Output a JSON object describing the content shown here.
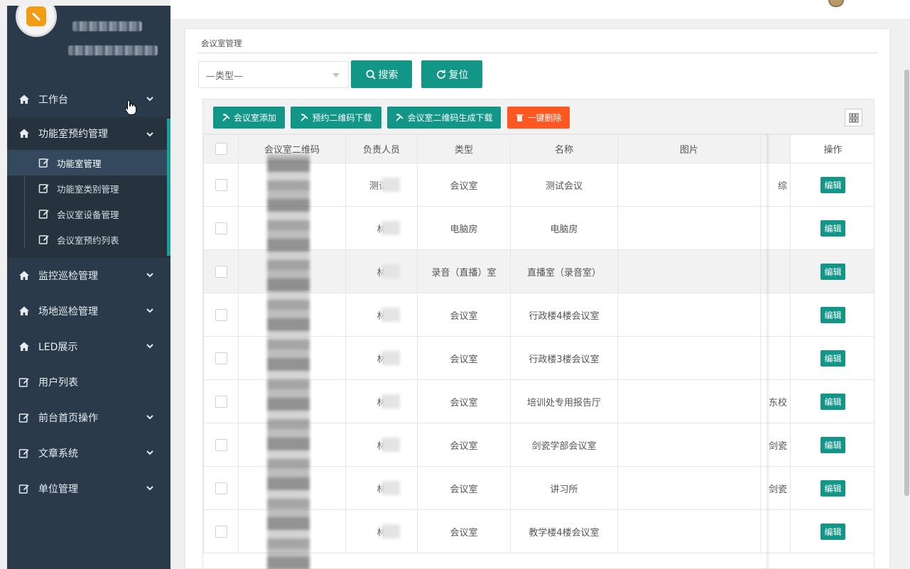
{
  "sidebar": {
    "menu": [
      {
        "label": "工作台",
        "icon": "home-icon",
        "has_chevron": true
      },
      {
        "label": "功能室预约管理",
        "icon": "home-icon",
        "has_chevron": true,
        "open": true,
        "children": [
          {
            "label": "功能室管理",
            "active": true
          },
          {
            "label": "功能室类别管理"
          },
          {
            "label": "会议室设备管理"
          },
          {
            "label": "会议室预约列表"
          }
        ]
      },
      {
        "label": "监控巡检管理",
        "icon": "home-icon",
        "has_chevron": true
      },
      {
        "label": "场地巡检管理",
        "icon": "home-icon",
        "has_chevron": true
      },
      {
        "label": "LED展示",
        "icon": "home-icon",
        "has_chevron": true
      },
      {
        "label": "用户列表",
        "icon": "edit-icon",
        "has_chevron": false
      },
      {
        "label": "前台首页操作",
        "icon": "edit-icon",
        "has_chevron": true
      },
      {
        "label": "文章系统",
        "icon": "edit-icon",
        "has_chevron": true
      },
      {
        "label": "单位管理",
        "icon": "edit-icon",
        "has_chevron": true
      }
    ]
  },
  "panel": {
    "breadcrumb": "会议室管理",
    "filter": {
      "type_value": "—类型—"
    },
    "search_label": "搜索",
    "reset_label": "复位",
    "toolbar": {
      "add_label": "会议室添加",
      "qr_booking_label": "预约二维码下载",
      "qr_room_label": "会议室二维码生成下载",
      "delete_all_label": "一键删除"
    }
  },
  "table": {
    "columns": [
      "会议室二维码",
      "负责人员",
      "类型",
      "名称",
      "图片",
      "",
      "操作"
    ],
    "edit_label": "编辑",
    "rows": [
      {
        "person": "测试2",
        "type": "会议室",
        "name": "测试会议",
        "extra": "综"
      },
      {
        "person": "林",
        "type": "电脑房",
        "name": "电脑房",
        "extra": ""
      },
      {
        "person": "林",
        "type": "录音（直播）室",
        "name": "直播室（录音室）",
        "extra": ""
      },
      {
        "person": "林",
        "type": "会议室",
        "name": "行政楼4楼会议室",
        "extra": ""
      },
      {
        "person": "林",
        "type": "会议室",
        "name": "行政楼3楼会议室",
        "extra": ""
      },
      {
        "person": "林",
        "type": "会议室",
        "name": "培训处专用报告厅",
        "extra": "东校"
      },
      {
        "person": "林",
        "type": "会议室",
        "name": "剑瓷学部会议室",
        "extra": "剑瓷"
      },
      {
        "person": "林",
        "type": "会议室",
        "name": "讲习所",
        "extra": "剑瓷"
      },
      {
        "person": "林",
        "type": "会议室",
        "name": "教学楼4楼会议室",
        "extra": ""
      }
    ]
  },
  "colors": {
    "sidebar_bg": "#2b3a4a",
    "accent": "#129688",
    "danger": "#ff5722",
    "active_bar": "#1aa094"
  }
}
